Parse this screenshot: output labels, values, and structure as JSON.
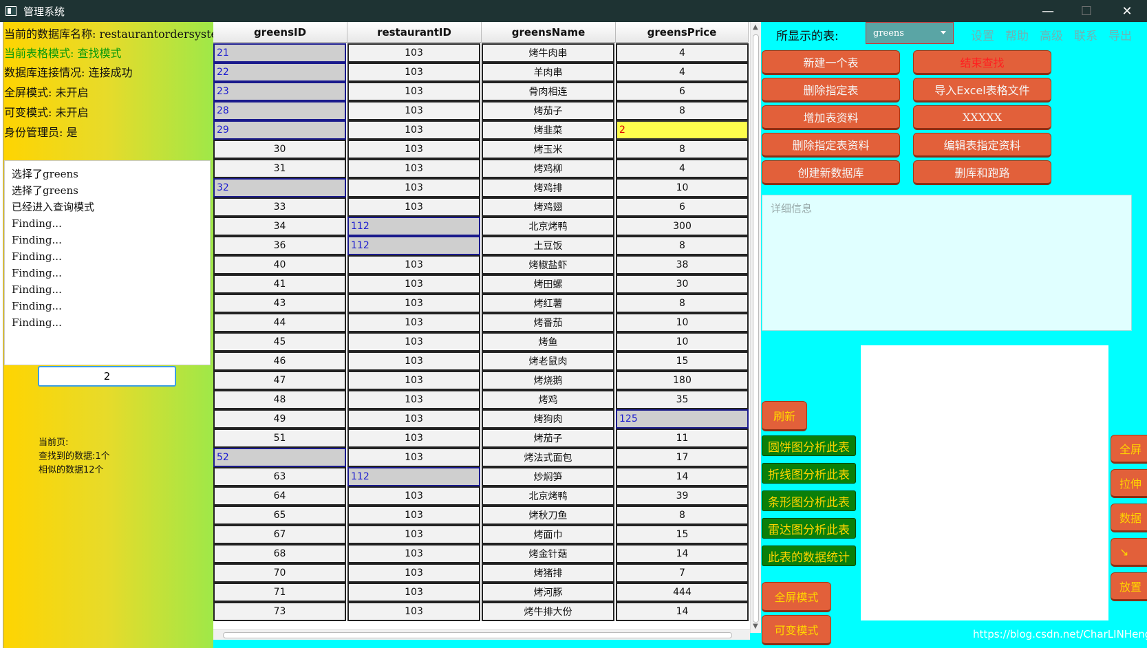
{
  "window": {
    "title": "管理系统",
    "minimize": "—",
    "maximize": "☐",
    "close": "✕"
  },
  "left": {
    "db_name": "当前的数据库名称: restaurantordersystem",
    "mode": "当前表格模式: 查找模式",
    "connection": "数据库连接情况: 连接成功",
    "fullscreen": "全屏模式: 未开启",
    "resizable": "可变模式: 未开启",
    "admin": "身份管理员: 是",
    "log": [
      "选择了greens",
      "选择了greens",
      "已经进入查询模式",
      "Finding...",
      "Finding...",
      "Finding...",
      "Finding...",
      "Finding...",
      "Finding...",
      "Finding..."
    ],
    "page_input": "2",
    "stats": [
      "当前页:",
      "查找到的数据:1个",
      "相似的数据12个"
    ]
  },
  "table": {
    "columns": [
      "greensID",
      "restaurantID",
      "greensName",
      "greensPrice"
    ],
    "rows": [
      {
        "c": [
          "21",
          "103",
          "烤牛肉串",
          "4"
        ],
        "hl": [
          0
        ]
      },
      {
        "c": [
          "22",
          "103",
          "羊肉串",
          "4"
        ],
        "hl": [
          0
        ]
      },
      {
        "c": [
          "23",
          "103",
          "骨肉相连",
          "6"
        ],
        "hl": [
          0
        ]
      },
      {
        "c": [
          "28",
          "103",
          "烤茄子",
          "8"
        ],
        "hl": [
          0
        ]
      },
      {
        "c": [
          "29",
          "103",
          "烤韭菜",
          "2"
        ],
        "hl": [
          0
        ],
        "edit": 3
      },
      {
        "c": [
          "30",
          "103",
          "烤玉米",
          "8"
        ],
        "hl": []
      },
      {
        "c": [
          "31",
          "103",
          "烤鸡柳",
          "4"
        ],
        "hl": []
      },
      {
        "c": [
          "32",
          "103",
          "烤鸡排",
          "10"
        ],
        "hl": [
          0
        ]
      },
      {
        "c": [
          "33",
          "103",
          "烤鸡翅",
          "6"
        ],
        "hl": []
      },
      {
        "c": [
          "34",
          "112",
          "北京烤鸭",
          "300"
        ],
        "hl": [
          1
        ]
      },
      {
        "c": [
          "36",
          "112",
          "土豆饭",
          "8"
        ],
        "hl": [
          1
        ]
      },
      {
        "c": [
          "40",
          "103",
          "烤椒盐虾",
          "38"
        ],
        "hl": []
      },
      {
        "c": [
          "41",
          "103",
          "烤田螺",
          "30"
        ],
        "hl": []
      },
      {
        "c": [
          "43",
          "103",
          "烤红薯",
          "8"
        ],
        "hl": []
      },
      {
        "c": [
          "44",
          "103",
          "烤番茄",
          "10"
        ],
        "hl": []
      },
      {
        "c": [
          "45",
          "103",
          "烤鱼",
          "10"
        ],
        "hl": []
      },
      {
        "c": [
          "46",
          "103",
          "烤老鼠肉",
          "15"
        ],
        "hl": []
      },
      {
        "c": [
          "47",
          "103",
          "烤烧鹅",
          "180"
        ],
        "hl": []
      },
      {
        "c": [
          "48",
          "103",
          "烤鸡",
          "35"
        ],
        "hl": []
      },
      {
        "c": [
          "49",
          "103",
          "烤狗肉",
          "125"
        ],
        "hl": [
          3
        ]
      },
      {
        "c": [
          "51",
          "103",
          "烤茄子",
          "11"
        ],
        "hl": []
      },
      {
        "c": [
          "52",
          "103",
          "烤法式面包",
          "17"
        ],
        "hl": [
          0
        ]
      },
      {
        "c": [
          "63",
          "112",
          "炒焖笋",
          "14"
        ],
        "hl": [
          1
        ]
      },
      {
        "c": [
          "64",
          "103",
          "北京烤鸭",
          "39"
        ],
        "hl": []
      },
      {
        "c": [
          "65",
          "103",
          "烤秋刀鱼",
          "8"
        ],
        "hl": []
      },
      {
        "c": [
          "67",
          "103",
          "烤面巾",
          "15"
        ],
        "hl": []
      },
      {
        "c": [
          "68",
          "103",
          "烤金针菇",
          "14"
        ],
        "hl": []
      },
      {
        "c": [
          "70",
          "103",
          "烤猪排",
          "7"
        ],
        "hl": []
      },
      {
        "c": [
          "71",
          "103",
          "烤河豚",
          "444"
        ],
        "hl": []
      },
      {
        "c": [
          "73",
          "103",
          "烤牛排大份",
          "14"
        ],
        "hl": []
      }
    ]
  },
  "right": {
    "shown_label": "所显示的表:",
    "selected_table": "greens",
    "menu": [
      "设置",
      "帮助",
      "高级",
      "联系",
      "导出"
    ],
    "buttons_left": [
      "新建一个表",
      "删除指定表",
      "增加表资料",
      "删除指定表资料",
      "创建新数据库"
    ],
    "buttons_right": [
      "结束查找",
      "导入Excel表格文件",
      "XXXXX",
      "编辑表指定资料",
      "删库和跑路"
    ],
    "detail_placeholder": "详细信息",
    "refresh": "刷新",
    "analysis": [
      "圆饼图分析此表",
      "折线图分析此表",
      "条形图分析此表",
      "雷达图分析此表",
      "此表的数据统计"
    ],
    "mode_buttons": [
      "全屏模式",
      "可变模式"
    ],
    "side_buttons": [
      "全屏",
      "拉伸",
      "数据",
      "↘",
      "放置"
    ],
    "watermark": "https://blog.csdn.net/CharLINHeng"
  },
  "colors": {
    "background": "#00ffff",
    "orange_button": "#e2603a",
    "green_button": "#0a7f0a",
    "highlight_text": "#1b1bd0",
    "edit_cell": "#ffff4d"
  }
}
